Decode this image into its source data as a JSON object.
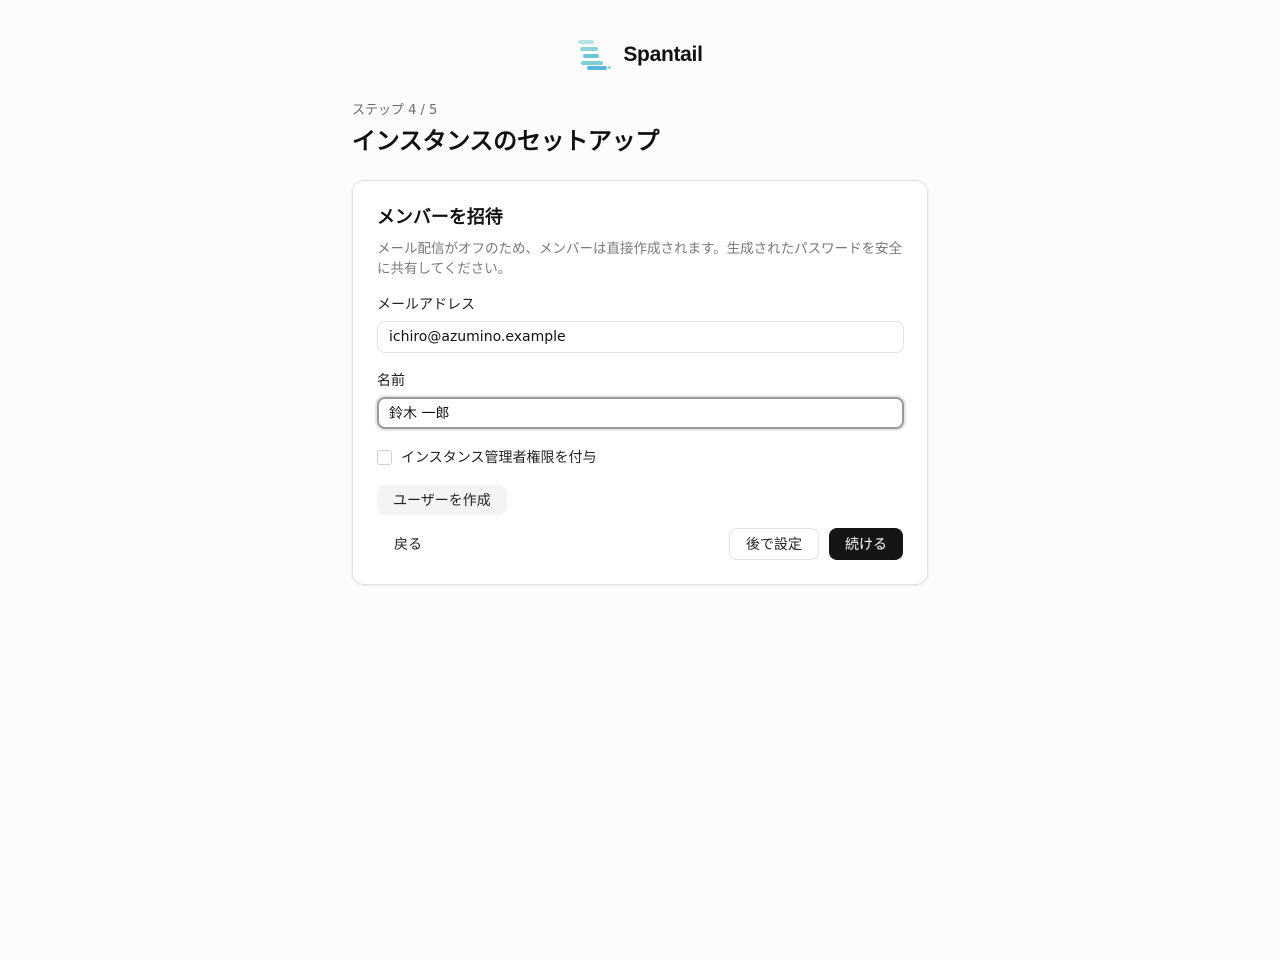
{
  "brand": {
    "name": "Spantail",
    "logo_icon": "spantail-logo-icon"
  },
  "header": {
    "step": "ステップ 4 / 5",
    "title": "インスタンスのセットアップ"
  },
  "card": {
    "title": "メンバーを招待",
    "description": "メール配信がオフのため、メンバーは直接作成されます。生成されたパスワードを安全に共有してください。",
    "email": {
      "label": "メールアドレス",
      "value": "ichiro@azumino.example"
    },
    "name": {
      "label": "名前",
      "value": "鈴木 一郎"
    },
    "admin_checkbox": {
      "label": "インスタンス管理者権限を付与",
      "checked": false
    },
    "create_button": "ユーザーを作成"
  },
  "footer": {
    "back": "戻る",
    "later": "後で設定",
    "continue": "続ける"
  },
  "colors": {
    "primary": "#151515",
    "logo_teal": "#7fd0d4",
    "logo_blue": "#5ab6e0"
  }
}
